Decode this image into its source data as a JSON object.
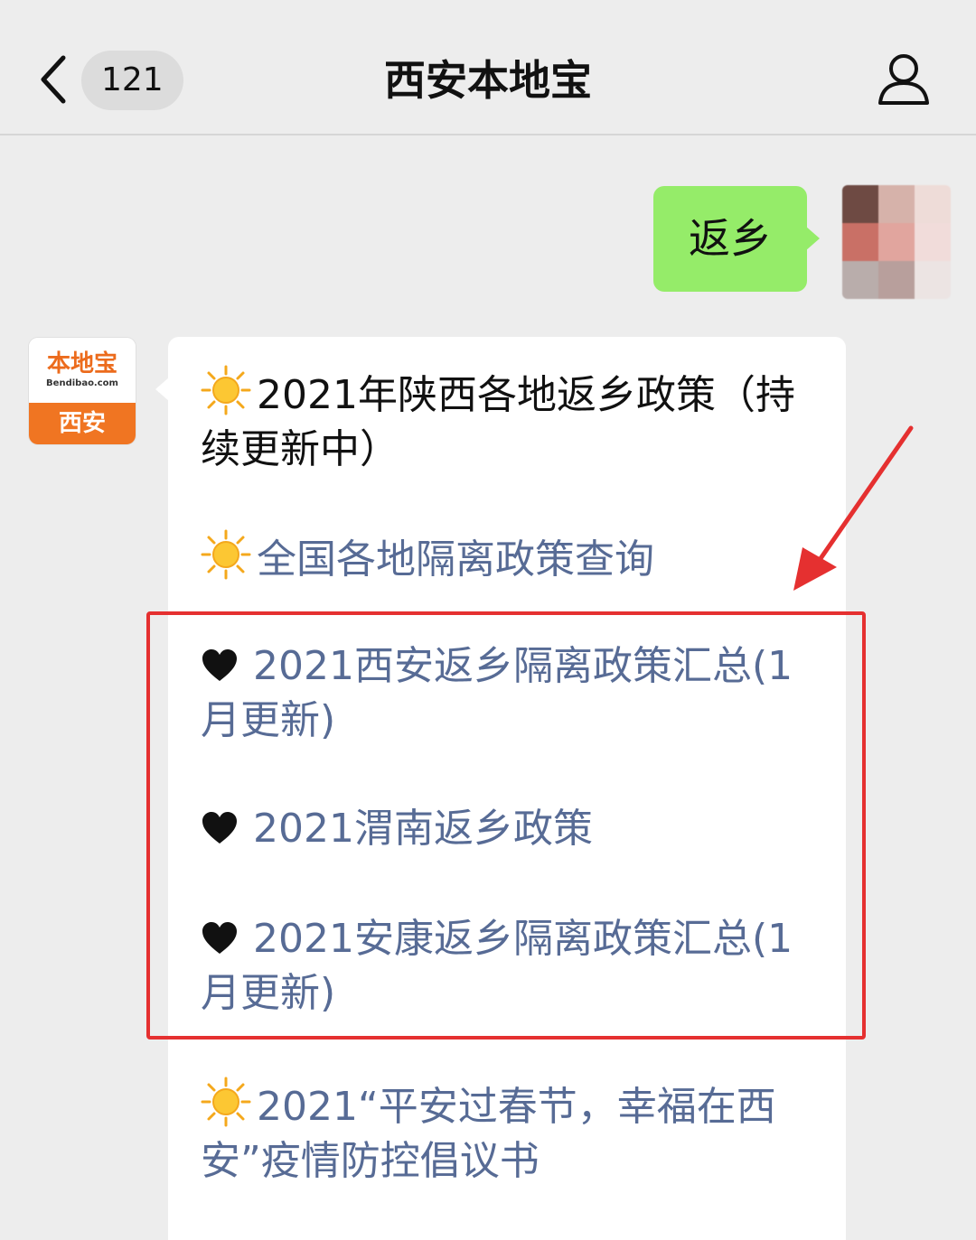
{
  "nav": {
    "unread_count": "121",
    "title": "西安本地宝"
  },
  "user_message": {
    "text": "返乡"
  },
  "bot": {
    "avatar_brand": "本地宝",
    "avatar_site": "Bendibao.com",
    "avatar_city": "西安"
  },
  "reply": {
    "items": [
      {
        "icon": "sun-icon",
        "text": "2021年陕西各地返乡政策（持续更新中）",
        "link": false
      },
      {
        "icon": "sun-icon",
        "text": "全国各地隔离政策查询",
        "link": true
      },
      {
        "icon": "heart-icon",
        "text": "2021西安返乡隔离政策汇总(1月更新)",
        "link": true
      },
      {
        "icon": "heart-icon",
        "text": "2021渭南返乡政策",
        "link": true
      },
      {
        "icon": "heart-icon",
        "text": "2021安康返乡隔离政策汇总(1月更新)",
        "link": true
      },
      {
        "icon": "sun-icon",
        "text": "2021“平安过春节，幸福在西安”疫情防控倡议书",
        "link": true
      }
    ]
  },
  "colors": {
    "background": "#ededed",
    "outgoing_bubble": "#95ec69",
    "link": "#576b95",
    "annotation_red": "#e53030"
  }
}
